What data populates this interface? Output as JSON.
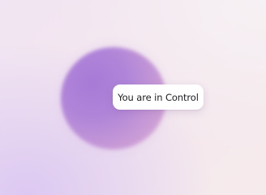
{
  "badge": {
    "label": "You are in Control"
  },
  "colors": {
    "orb_primary": "#a77ad6",
    "orb_secondary": "#e6b8d8",
    "background": "#f3e6ee",
    "pill_background": "#ffffff",
    "text": "#1c1c22"
  }
}
